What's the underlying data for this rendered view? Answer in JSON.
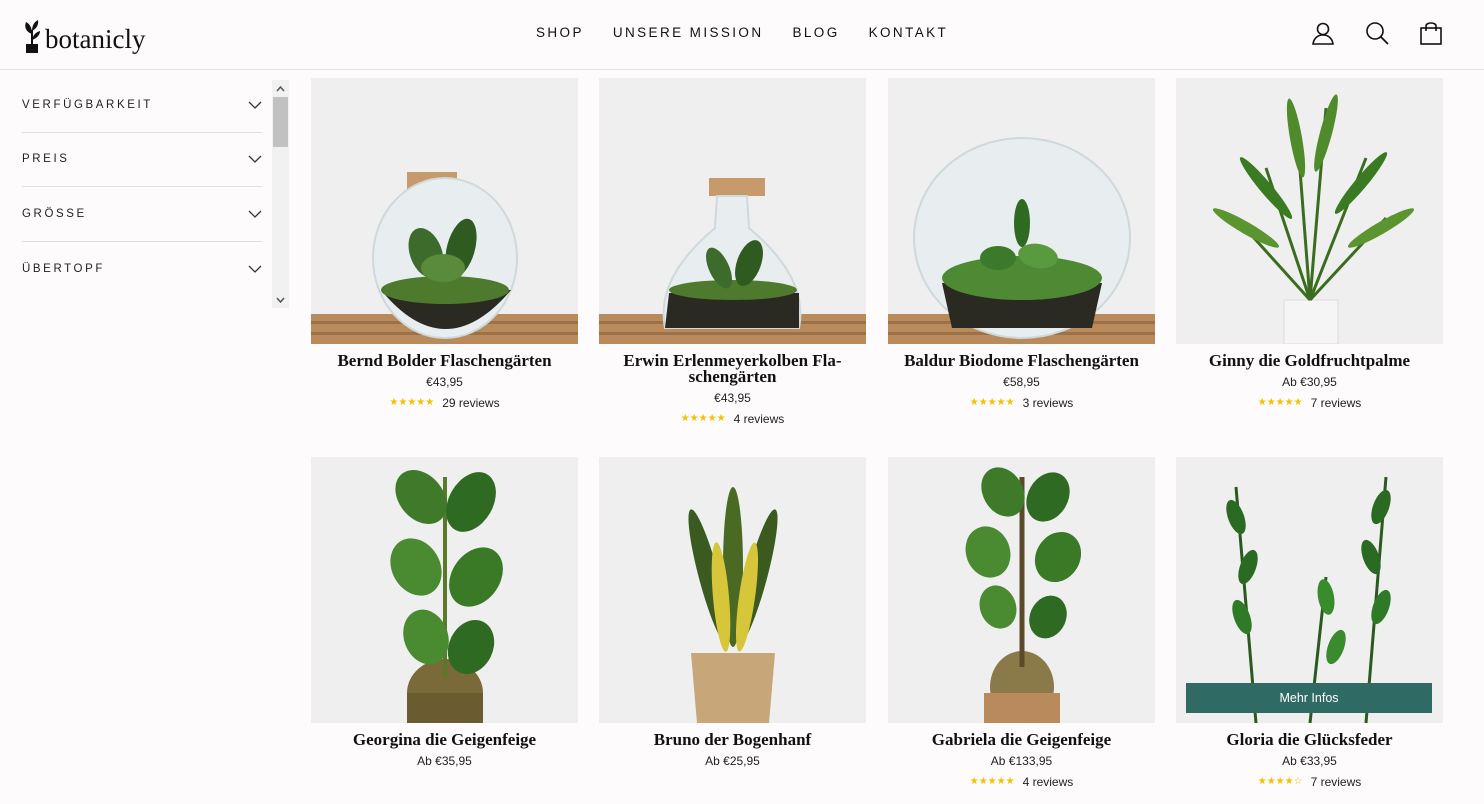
{
  "brand": {
    "name": "botanicly"
  },
  "nav": [
    "SHOP",
    "UNSERE MISSION",
    "BLOG",
    "KONTAKT"
  ],
  "header_icons": [
    "user-icon",
    "search-icon",
    "cart-icon"
  ],
  "filters": [
    "VERFÜGBARKEIT",
    "PREIS",
    "GRÖSSE",
    "ÜBERTOPF"
  ],
  "colors": {
    "accent": "#2f6b64",
    "star": "#f2c200",
    "background": "#fdfbfb"
  },
  "products": [
    {
      "title": "Bernd Bolder Flaschengärten",
      "price": "€43,95",
      "rating": 4.5,
      "reviews": "29 reviews",
      "kind": "terrarium-round"
    },
    {
      "title": "Erwin Erlenmeyerkolben Fla-schengärten",
      "title_lines": [
        "Erwin Erlenmeyerkolben Fla-",
        "schengärten"
      ],
      "price": "€43,95",
      "rating": 4.5,
      "reviews": "4 reviews",
      "kind": "terrarium-flask"
    },
    {
      "title": "Baldur Biodome Flaschengärten",
      "price": "€58,95",
      "rating": 4.5,
      "reviews": "3 reviews",
      "kind": "terrarium-dome"
    },
    {
      "title": "Ginny die Goldfruchtpalme",
      "price": "Ab €30,95",
      "rating": 5,
      "reviews": "7 reviews",
      "kind": "palm"
    },
    {
      "title": "Georgina die Geigenfeige",
      "price": "Ab €35,95",
      "rating": null,
      "reviews": "",
      "kind": "fig-brass"
    },
    {
      "title": "Bruno der Bogenhanf",
      "price": "Ab €25,95",
      "rating": null,
      "reviews": "",
      "kind": "snake"
    },
    {
      "title": "Gabriela die Geigenfeige",
      "price": "Ab €133,95",
      "rating": 4.5,
      "reviews": "4 reviews",
      "kind": "fig-tree"
    },
    {
      "title": "Gloria die Glücksfeder",
      "price": "Ab €33,95",
      "rating": 4,
      "reviews": "7 reviews",
      "kind": "zz",
      "hover_label": "Mehr Infos"
    }
  ]
}
